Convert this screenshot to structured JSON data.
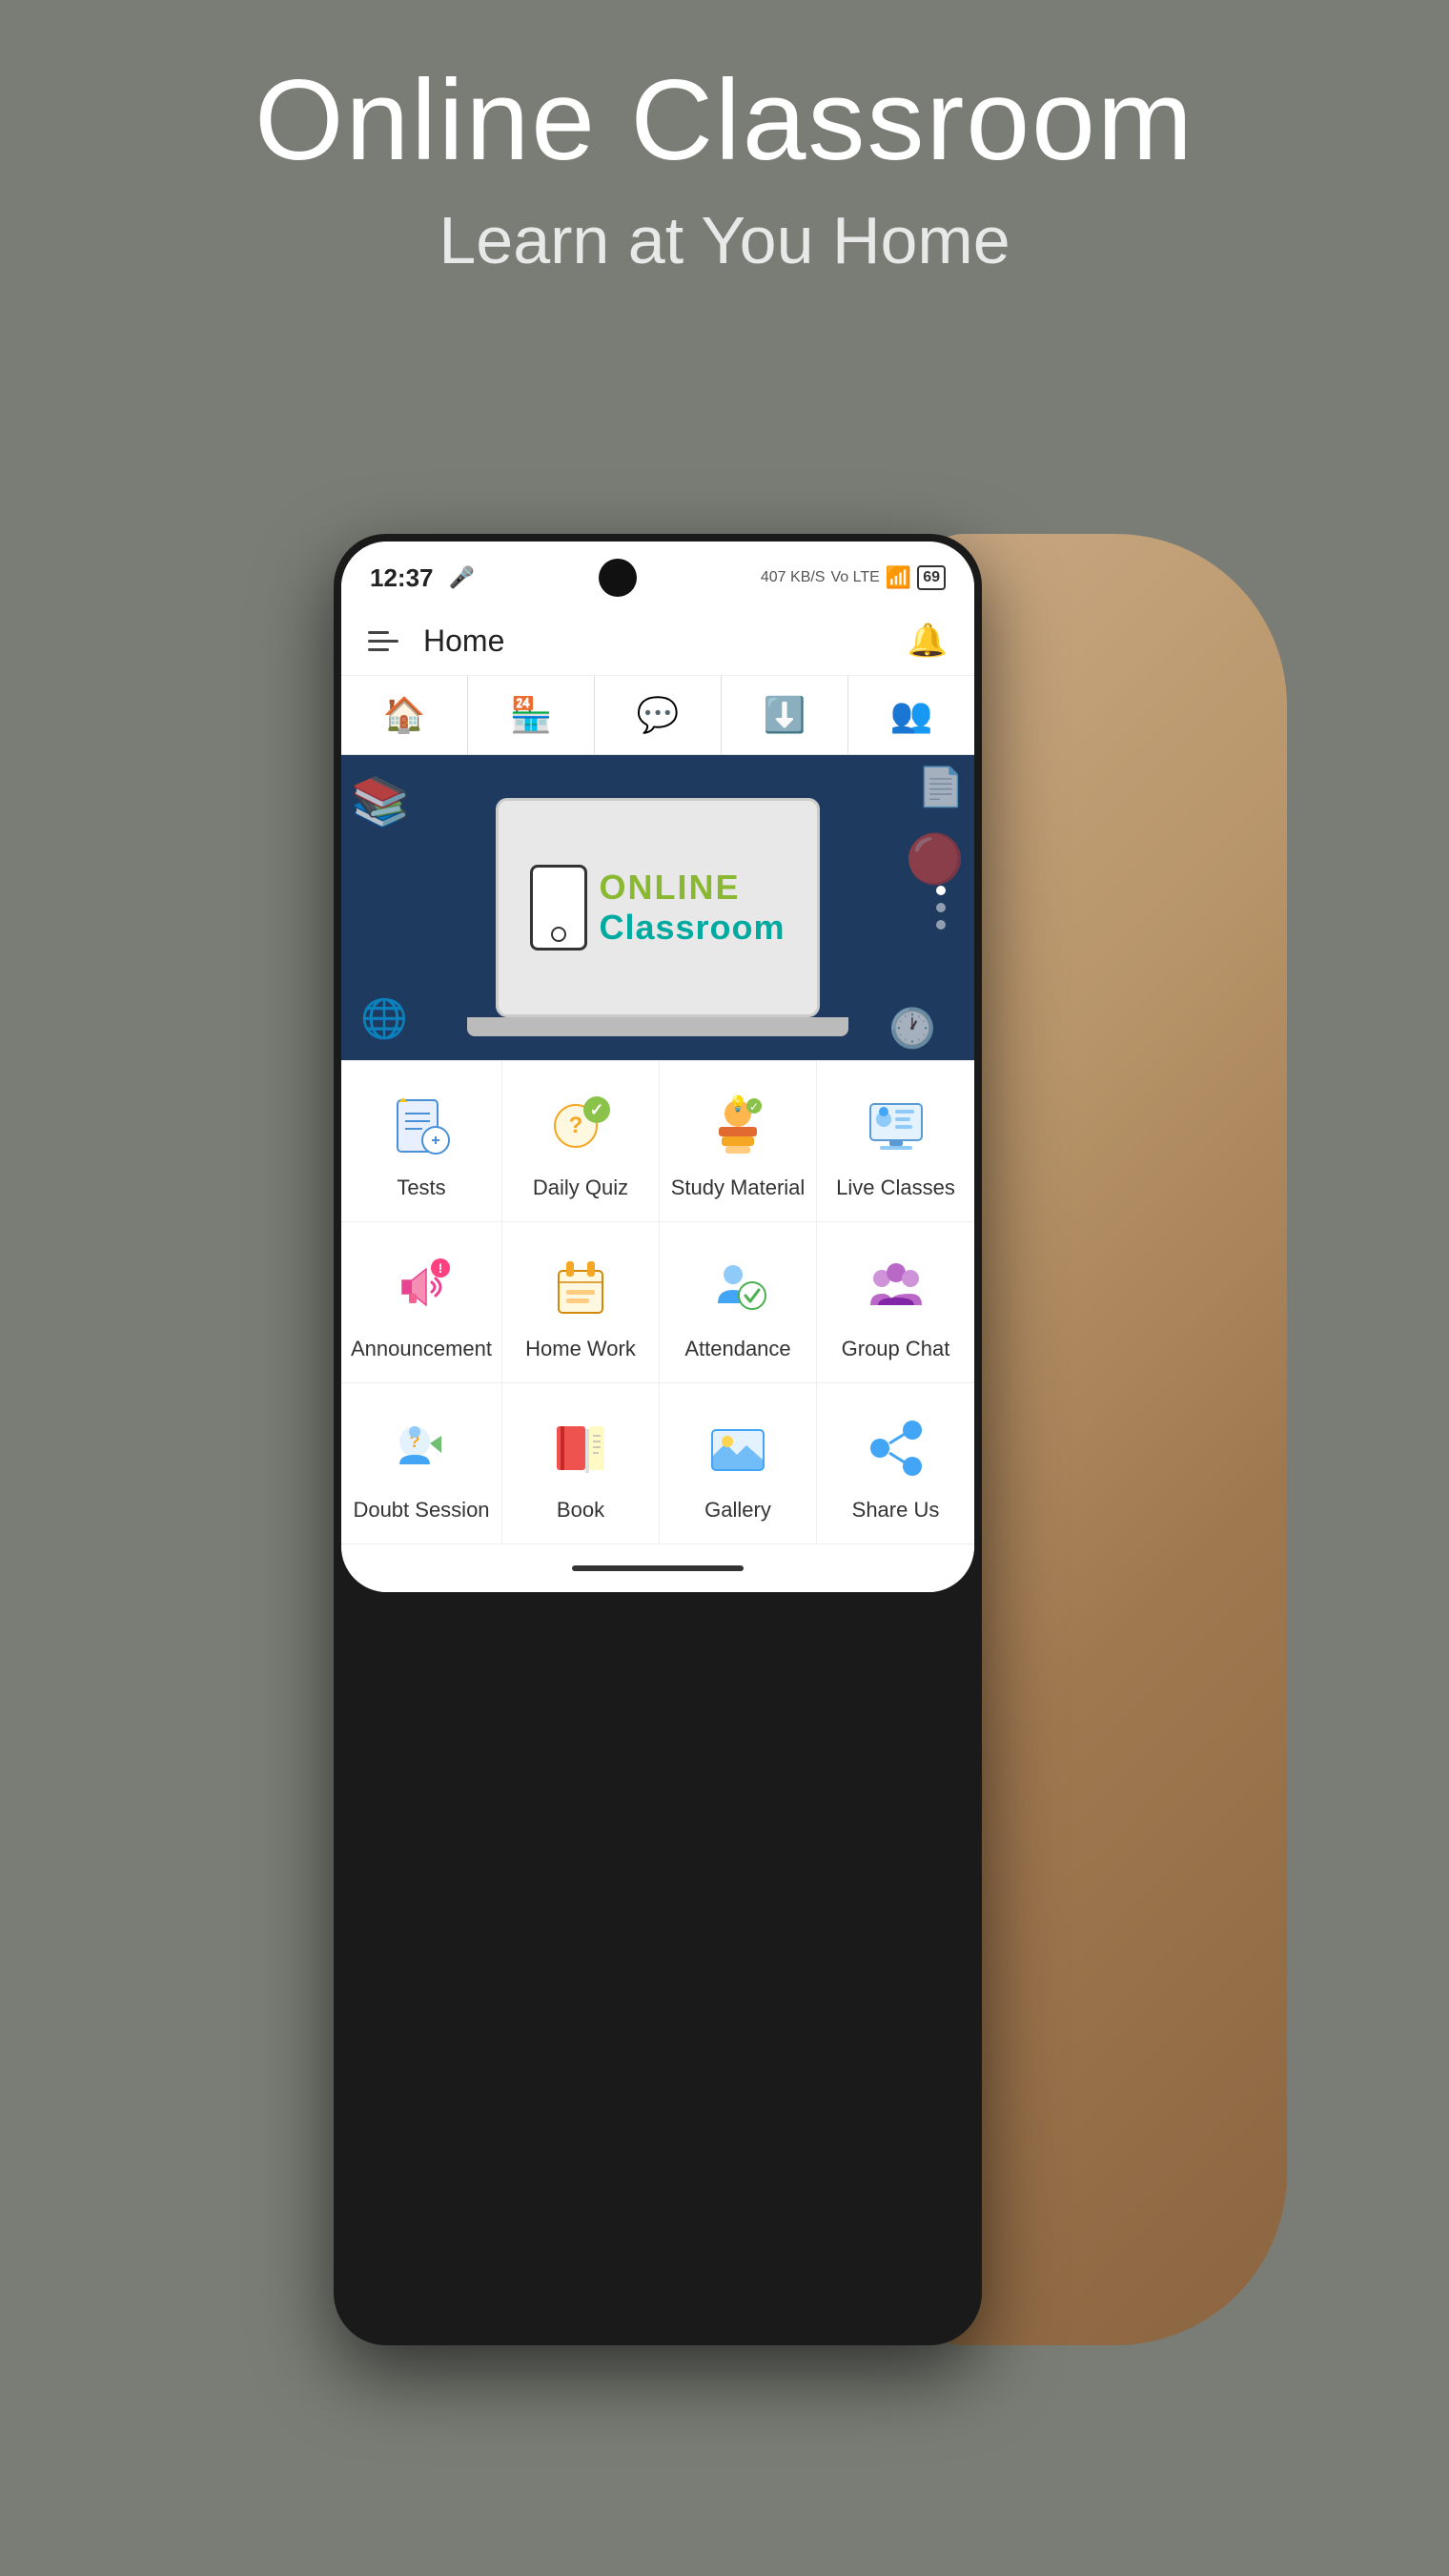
{
  "page": {
    "bg_color": "#7a7d75",
    "title": "Online Classroom",
    "subtitle": "Learn at You Home"
  },
  "status_bar": {
    "time": "12:37",
    "network_info": "407 KB/S",
    "network_type": "Vo LTE",
    "signal": "4G",
    "battery": "69"
  },
  "nav": {
    "title": "Home"
  },
  "tabs": [
    {
      "icon": "🏠",
      "label": "Home",
      "active": true
    },
    {
      "icon": "🏪",
      "label": "Shop",
      "active": false
    },
    {
      "icon": "💬",
      "label": "Chat",
      "active": false
    },
    {
      "icon": "⬇️",
      "label": "Download",
      "active": false
    },
    {
      "icon": "👥",
      "label": "Profile",
      "active": false
    }
  ],
  "banner": {
    "online_text": "ONLINE",
    "classroom_text": "Classroom"
  },
  "menu_items": [
    {
      "id": "tests",
      "label": "Tests",
      "emoji": "📋",
      "color": "#4a90d9"
    },
    {
      "id": "daily-quiz",
      "label": "Daily Quiz",
      "emoji": "❓",
      "color": "#f5a623"
    },
    {
      "id": "study-material",
      "label": "Study Material",
      "emoji": "📚",
      "color": "#e06a2f"
    },
    {
      "id": "live-classes",
      "label": "Live Classes",
      "emoji": "🖥️",
      "color": "#5b9bd5"
    },
    {
      "id": "announcement",
      "label": "Announcement",
      "emoji": "📣",
      "color": "#e84393"
    },
    {
      "id": "home-work",
      "label": "Home Work",
      "emoji": "📖",
      "color": "#d4880a"
    },
    {
      "id": "attendance",
      "label": "Attendance",
      "emoji": "✅",
      "color": "#4a90d9"
    },
    {
      "id": "group-chat",
      "label": "Group Chat",
      "emoji": "👨‍👩‍👧",
      "color": "#8b6db5"
    },
    {
      "id": "doubt-session",
      "label": "Doubt Session",
      "emoji": "🙋",
      "color": "#4a90d9"
    },
    {
      "id": "book",
      "label": "Book",
      "emoji": "📕",
      "color": "#e06a2f"
    },
    {
      "id": "gallery",
      "label": "Gallery",
      "emoji": "🖼️",
      "color": "#4a90d9"
    },
    {
      "id": "share-us",
      "label": "Share Us",
      "emoji": "📤",
      "color": "#4a90d9"
    }
  ]
}
